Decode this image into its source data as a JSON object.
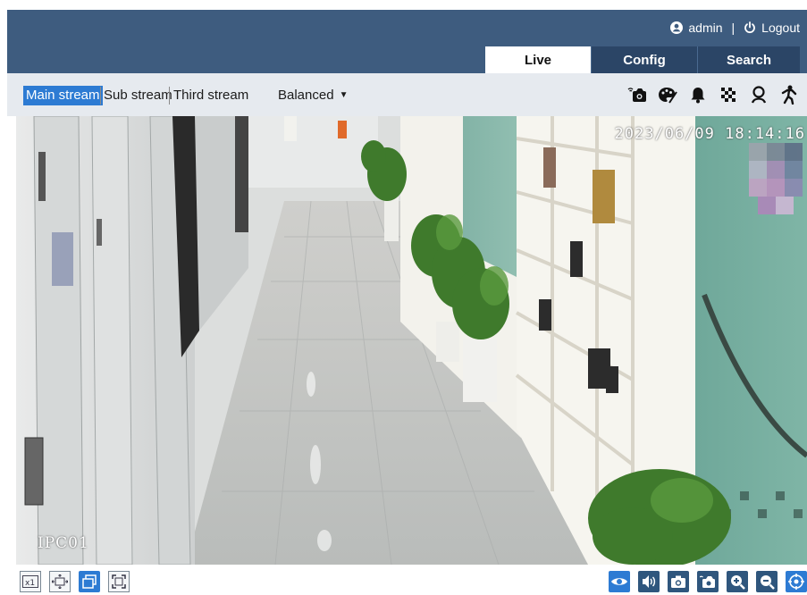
{
  "header": {
    "user": "admin",
    "separator": "|",
    "logout_label": "Logout",
    "tabs": [
      {
        "label": "Live",
        "active": true
      },
      {
        "label": "Config",
        "active": false
      },
      {
        "label": "Search",
        "active": false
      }
    ]
  },
  "stream_bar": {
    "streams": [
      {
        "label": "Main stream",
        "selected": true
      },
      {
        "label": "Sub stream",
        "selected": false
      },
      {
        "label": "Third stream",
        "selected": false
      }
    ],
    "quality": "Balanced",
    "icons": [
      "record-icon",
      "palette-icon",
      "alarm-bell-icon",
      "mosaic-icon",
      "face-detection-icon",
      "person-detection-icon"
    ]
  },
  "video": {
    "timestamp": "2023/06/09 18:14:16",
    "channel_name": "IPC01"
  },
  "bottom_bar": {
    "left_icons": [
      "original-size-icon",
      "fit-stretch-icon",
      "window-mode-icon",
      "fullscreen-icon"
    ],
    "right_icons": [
      "eye-icon",
      "audio-icon",
      "snapshot-icon",
      "record-icon",
      "zoom-in-icon",
      "zoom-out-icon",
      "ptz-icon"
    ]
  },
  "colors": {
    "header_bg": "#3e5c7f",
    "tab_dark": "#2b4566",
    "toolbar_bg": "#e6eaef",
    "selected_blue": "#2d7bd3",
    "icon_dark": "#2f567d"
  }
}
